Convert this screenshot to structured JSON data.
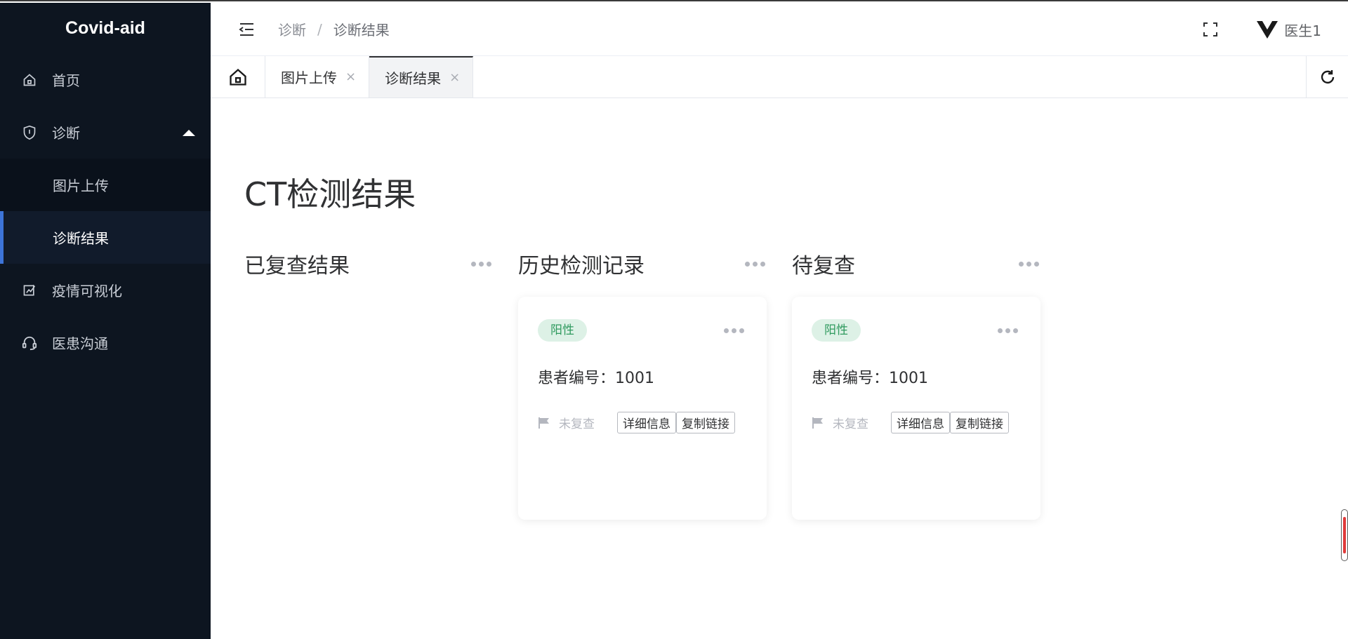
{
  "app": {
    "brand": "Covid-aid"
  },
  "sidebar": {
    "items": [
      {
        "label": "首页",
        "icon": "home-icon"
      },
      {
        "label": "诊断",
        "icon": "shield-icon",
        "expanded": true,
        "children": [
          {
            "label": "图片上传",
            "active": false
          },
          {
            "label": "诊断结果",
            "active": true
          }
        ]
      },
      {
        "label": "疫情可视化",
        "icon": "chart-edit-icon"
      },
      {
        "label": "医患沟通",
        "icon": "headset-icon"
      }
    ]
  },
  "header": {
    "breadcrumb": [
      "诊断",
      "诊断结果"
    ],
    "separator": "/",
    "user": "医生1"
  },
  "tabs": [
    {
      "label": "图片上传",
      "close": "×",
      "active": false
    },
    {
      "label": "诊断结果",
      "close": "×",
      "active": true
    }
  ],
  "main": {
    "title": "CT检测结果",
    "columns": [
      {
        "title": "已复查结果",
        "cards": []
      },
      {
        "title": "历史检测记录",
        "cards": [
          {
            "tag": "阳性",
            "patient": "患者编号：1001",
            "status": "未复查",
            "detail_btn": "详细信息",
            "copy_btn": "复制链接"
          }
        ]
      },
      {
        "title": "待复查",
        "cards": [
          {
            "tag": "阳性",
            "patient": "患者编号：1001",
            "status": "未复查",
            "detail_btn": "详细信息",
            "copy_btn": "复制链接"
          }
        ]
      }
    ]
  },
  "colors": {
    "sidebar_bg": "#0d1520",
    "active_accent": "#3d74d8",
    "tag_bg": "#ddf1e6",
    "tag_text": "#2f9a5e"
  }
}
